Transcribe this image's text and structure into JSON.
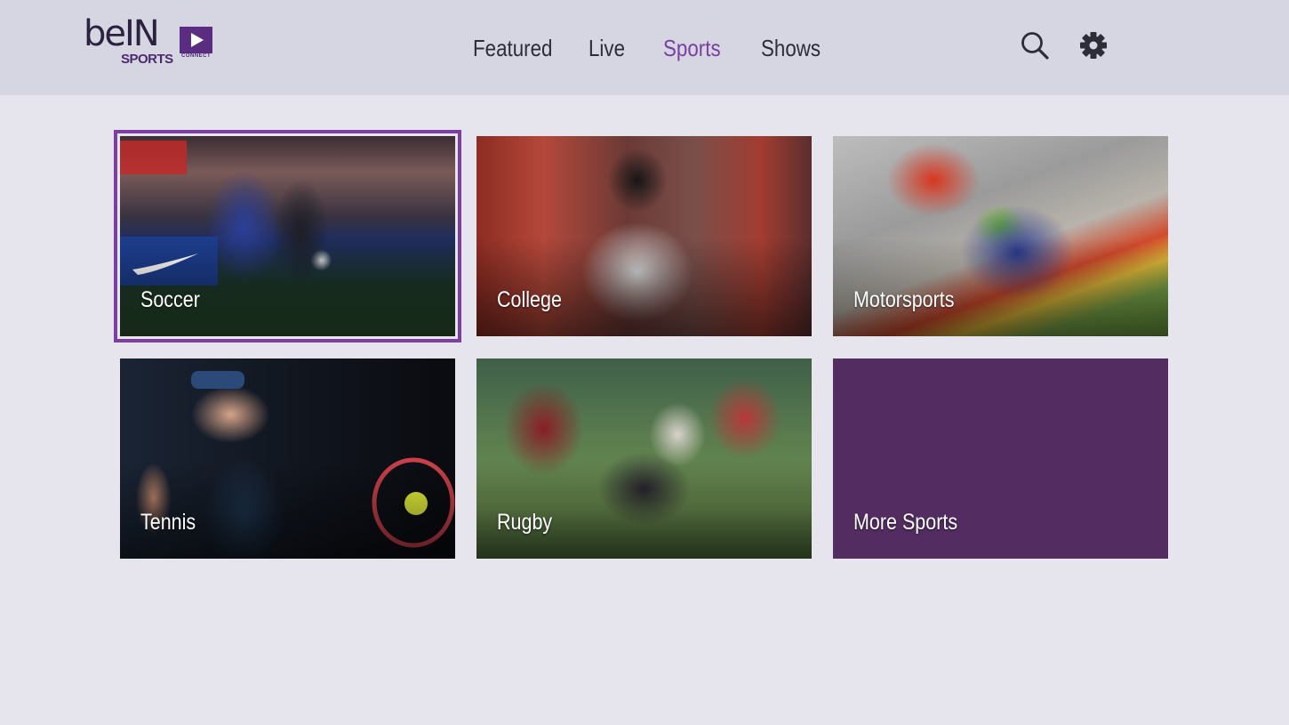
{
  "brand": {
    "logo_text": "beIN",
    "logo_sub": "SPORTS",
    "logo_connect": "CONNECT",
    "accent_color": "#7b3fa0",
    "tile_purple": "#532d62"
  },
  "nav": {
    "items": [
      {
        "label": "Featured",
        "active": false
      },
      {
        "label": "Live",
        "active": false
      },
      {
        "label": "Sports",
        "active": true
      },
      {
        "label": "Shows",
        "active": false
      }
    ]
  },
  "toolbar": {
    "search_icon": "search-icon",
    "settings_icon": "gear-icon"
  },
  "tiles": [
    {
      "label": "Soccer",
      "focused": true
    },
    {
      "label": "College",
      "focused": false
    },
    {
      "label": "Motorsports",
      "focused": false
    },
    {
      "label": "Tennis",
      "focused": false
    },
    {
      "label": "Rugby",
      "focused": false
    },
    {
      "label": "More Sports",
      "focused": false
    }
  ]
}
